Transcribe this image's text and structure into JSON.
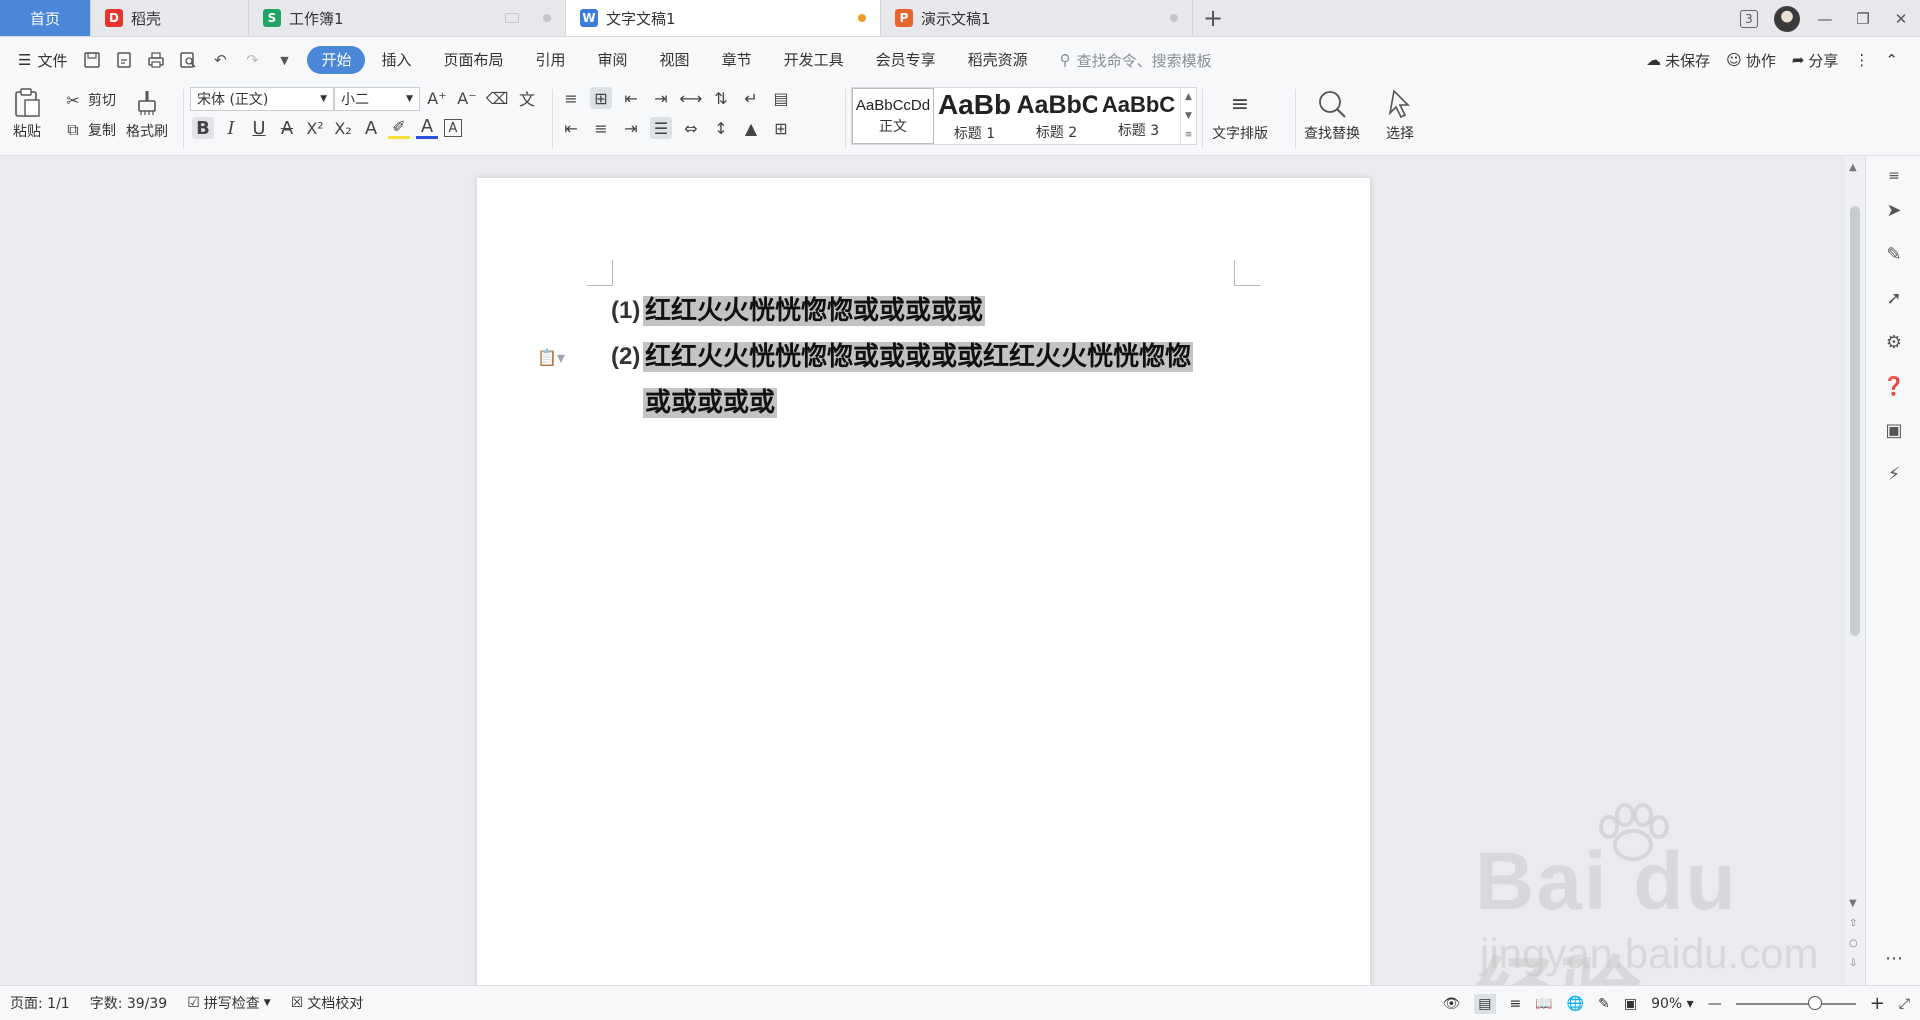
{
  "tabs": [
    {
      "label": "首页",
      "kind": "home"
    },
    {
      "label": "稻壳",
      "icon_letter": "D",
      "icon_color": "#e8342c"
    },
    {
      "label": "工作簿1",
      "icon_letter": "S",
      "icon_color": "#1fa463"
    },
    {
      "label": "文字文稿1",
      "icon_letter": "W",
      "icon_color": "#3b7ddd",
      "active": true
    },
    {
      "label": "演示文稿1",
      "icon_letter": "P",
      "icon_color": "#e8642c"
    }
  ],
  "window": {
    "window_count": "3"
  },
  "menu": {
    "file_label": "文件",
    "tabs": [
      "开始",
      "插入",
      "页面布局",
      "引用",
      "审阅",
      "视图",
      "章节",
      "开发工具",
      "会员专享",
      "稻壳资源"
    ],
    "search_placeholder": "查找命令、搜索模板",
    "unsaved": "未保存",
    "collab": "协作",
    "share": "分享"
  },
  "ribbon": {
    "paste": "粘贴",
    "cut": "剪切",
    "copy": "复制",
    "format_painter": "格式刷",
    "font_name": "宋体 (正文)",
    "font_size": "小二",
    "styles": [
      {
        "preview": "AaBbCcDd",
        "name": "正文"
      },
      {
        "preview": "AaBb",
        "name": "标题 1"
      },
      {
        "preview": "AaBbC",
        "name": "标题 2"
      },
      {
        "preview": "AaBbC",
        "name": "标题 3"
      }
    ],
    "text_layout": "文字排版",
    "find_replace": "查找替换",
    "select": "选择"
  },
  "document": {
    "items": [
      {
        "num": "(1)",
        "lines": [
          "红红火火恍恍惚惚或或或或或"
        ]
      },
      {
        "num": "(2)",
        "lines": [
          "红红火火恍恍惚惚或或或或或红红火火恍恍惚惚",
          "或或或或或"
        ]
      }
    ]
  },
  "status": {
    "page": "页面: 1/1",
    "words": "字数: 39/39",
    "spell": "拼写检查",
    "proof": "文档校对",
    "zoom": "90%"
  },
  "watermark": {
    "brand": "Bai du 经验",
    "url": "jingyan.baidu.com"
  }
}
